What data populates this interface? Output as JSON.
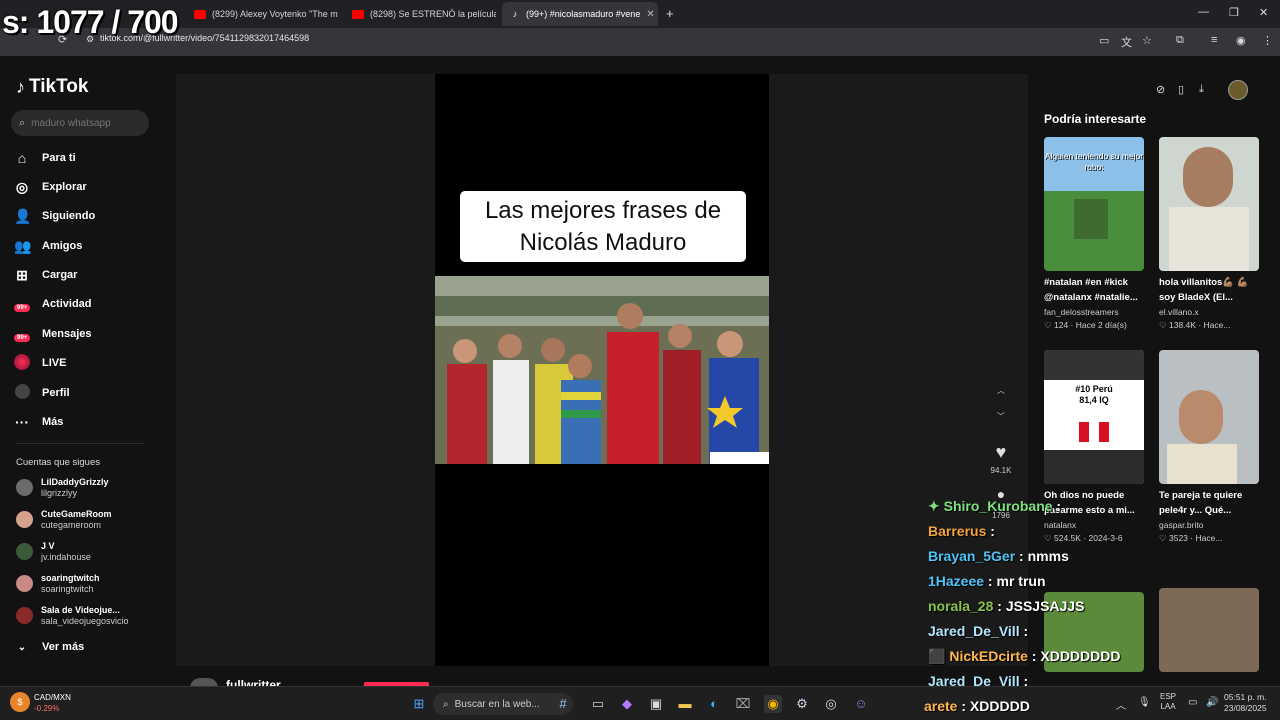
{
  "overlay_counter": "s: 1077 / 700",
  "tabs": [
    {
      "label": "(8299) Alexey Voytenko \"The m",
      "kind": "youtube"
    },
    {
      "label": "(8298) Se ESTRENÓ la película",
      "kind": "youtube"
    },
    {
      "label": "(99+) #nicolasmaduro #vene",
      "kind": "tiktok",
      "active": true
    }
  ],
  "address": {
    "url": "tiktok.com/@fullwritter/video/7541129832017464598"
  },
  "sidebar": {
    "brand": "TikTok",
    "search_placeholder": "maduro whatsapp",
    "nav": [
      {
        "label": "Para ti",
        "icon": "home-icon"
      },
      {
        "label": "Explorar",
        "icon": "compass-icon"
      },
      {
        "label": "Siguiendo",
        "icon": "following-icon"
      },
      {
        "label": "Amigos",
        "icon": "friends-icon"
      },
      {
        "label": "Cargar",
        "icon": "upload-icon"
      },
      {
        "label": "Actividad",
        "icon": "activity-icon",
        "badge": "99+"
      },
      {
        "label": "Mensajes",
        "icon": "messages-icon",
        "badge": "99+"
      },
      {
        "label": "LIVE",
        "icon": "live-icon"
      },
      {
        "label": "Perfil",
        "icon": "profile-icon"
      },
      {
        "label": "Más",
        "icon": "more-icon"
      }
    ],
    "following_header": "Cuentas que sigues",
    "accounts": [
      {
        "name": "LilDaddyGrizzly",
        "handle": "lilgrizzlyy"
      },
      {
        "name": "CuteGameRoom",
        "handle": "cutegameroom"
      },
      {
        "name": "J V",
        "handle": "jv.indahouse"
      },
      {
        "name": "soaringtwitch",
        "handle": "soaringtwitch"
      },
      {
        "name": "Sala de Videojue...",
        "handle": "sala_videojuegosvicio"
      }
    ],
    "see_more": "Ver más"
  },
  "video": {
    "title_line1": "Las mejores frases de",
    "title_line2": "Nicolás Maduro",
    "likes": "94.1K",
    "comments": "1796",
    "creator": "fullwritter"
  },
  "suggestions": {
    "header": "Podría interesarte",
    "items": [
      {
        "caption": "#natalan #en #kick @natalanx #natalie...",
        "author": "fan_delosstreamers",
        "likes": "124",
        "date": "Hace 2 día(s)",
        "thumb_text": "Alguien teniendo su mejor robo:"
      },
      {
        "caption": "hola villanitos💪🏽 💪🏽 soy BladeX (El...",
        "author": "el.villano.x",
        "likes": "138.4K",
        "date": "Hace...",
        "thumb_text": ""
      },
      {
        "caption": "Oh dios no puede pasarme esto a mi...",
        "author": "natalanx",
        "likes": "524.5K",
        "date": "2024-3-6",
        "thumb_text": "#10 Perú 81,4 IQ"
      },
      {
        "caption": "Te pareja te quiere pele4r y... Qué...",
        "author": "gaspar.brito",
        "likes": "3523",
        "date": "Hace...",
        "thumb_text": ""
      }
    ]
  },
  "chat": [
    {
      "user": "Shiro_Kurobane",
      "msg": "",
      "color": "#7ee07e"
    },
    {
      "user": "Barrerus",
      "msg": "",
      "color": "#f2a33a"
    },
    {
      "user": "Brayan_5Ger",
      "msg": "nmms",
      "color": "#4fc3f7"
    },
    {
      "user": "1Hazeee",
      "msg": "mr trun",
      "color": "#4fc3f7"
    },
    {
      "user": "norala_28",
      "msg": "JSSJSAJJS",
      "color": "#8bc34a"
    },
    {
      "user": "Jared_De_Vill",
      "msg": "",
      "color": "#b3e5fc"
    },
    {
      "user": "NickEDcirte",
      "msg": "XDDDDDDD",
      "color": "#ffb74d"
    },
    {
      "user": "Jared_De_Vill",
      "msg": "",
      "color": "#b3e5fc"
    },
    {
      "user": "arete",
      "msg": "XDDDDD",
      "color": "#ffb74d"
    }
  ],
  "taskbar": {
    "search_placeholder": "Buscar en la web...",
    "ticker_name": "CAD/MXN",
    "ticker_change": "-0.29%",
    "lang1": "ESP",
    "lang2": "LAA",
    "time": "05:51 p. m.",
    "date": "23/08/2025"
  },
  "colors": {
    "accent": "#fe2c55",
    "bg": "#121212"
  }
}
